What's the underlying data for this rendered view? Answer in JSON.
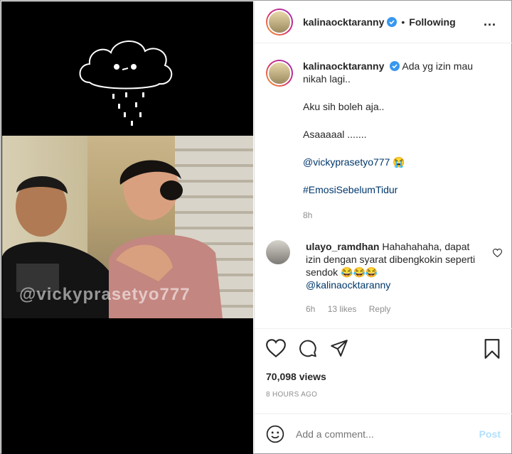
{
  "media": {
    "watermark": "@vickyprasetyo777"
  },
  "header": {
    "username": "kalinaocktaranny",
    "separator": "•",
    "follow_label": "Following",
    "more_label": "..."
  },
  "caption": {
    "username": "kalinaocktaranny",
    "line1": "Ada yg izin mau nikah lagi..",
    "line2": "Aku sih boleh aja..",
    "line3": "Asaaaaal .......",
    "mention": "@vickyprasetyo777",
    "emoji": "😭",
    "hashtag": "#EmosiSebelumTidur",
    "time": "8h"
  },
  "comment": {
    "username": "ulayo_ramdhan",
    "text": "Hahahahaha, dapat izin dengan syarat dibengkokin seperti sendok 😂😂😂",
    "mention": "@kalinaocktaranny",
    "time": "6h",
    "likes": "13 likes",
    "reply": "Reply"
  },
  "stats": {
    "views": "70,098 views",
    "ago": "8 HOURS AGO"
  },
  "add_comment": {
    "placeholder": "Add a comment...",
    "post_label": "Post"
  },
  "colors": {
    "link": "#00376b",
    "verified": "#3897f0",
    "post_disabled": "#b2dffc"
  }
}
